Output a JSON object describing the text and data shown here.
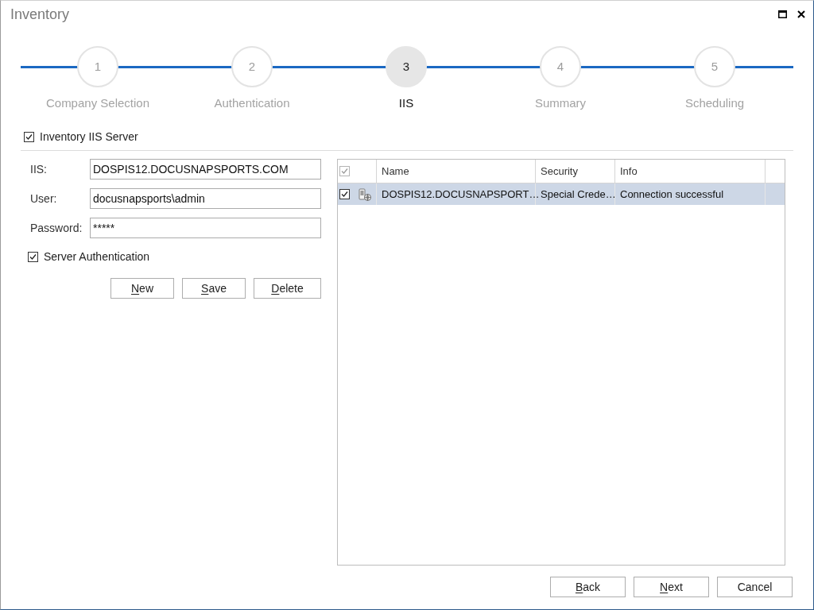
{
  "window": {
    "title": "Inventory"
  },
  "steps": [
    {
      "number": "1",
      "label": "Company Selection",
      "selected": false
    },
    {
      "number": "2",
      "label": "Authentication",
      "selected": false
    },
    {
      "number": "3",
      "label": "IIS",
      "selected": true
    },
    {
      "number": "4",
      "label": "Summary",
      "selected": false
    },
    {
      "number": "5",
      "label": "Scheduling",
      "selected": false
    }
  ],
  "inventory_iis_server": {
    "label": "Inventory IIS Server",
    "checked": true
  },
  "form": {
    "fields": [
      {
        "label": "IIS:",
        "value": "DOSPIS12.DOCUSNAPSPORTS.COM"
      },
      {
        "label": "User:",
        "value": "docusnapsports\\admin"
      },
      {
        "label": "Password:",
        "value": "*****"
      }
    ],
    "server_authentication": {
      "label": "Server Authentication",
      "checked": true
    },
    "buttons": [
      {
        "label": "New",
        "access_key_underlined": true
      },
      {
        "label": "Save",
        "access_key_underlined": true
      },
      {
        "label": "Delete",
        "access_key_underlined": true
      }
    ]
  },
  "table": {
    "header_checked": true,
    "columns": [
      "Name",
      "Security",
      "Info"
    ],
    "rows": [
      {
        "checked": true,
        "selected": true,
        "cells": [
          "DOSPIS12.DOCUSNAPSPORT…",
          "Special Crede…",
          "Connection successful"
        ]
      }
    ]
  },
  "footer_buttons": [
    {
      "label": "Back",
      "access_key_underlined": true
    },
    {
      "label": "Next",
      "access_key_underlined": true
    },
    {
      "label": "Cancel",
      "access_key_underlined": false
    }
  ]
}
